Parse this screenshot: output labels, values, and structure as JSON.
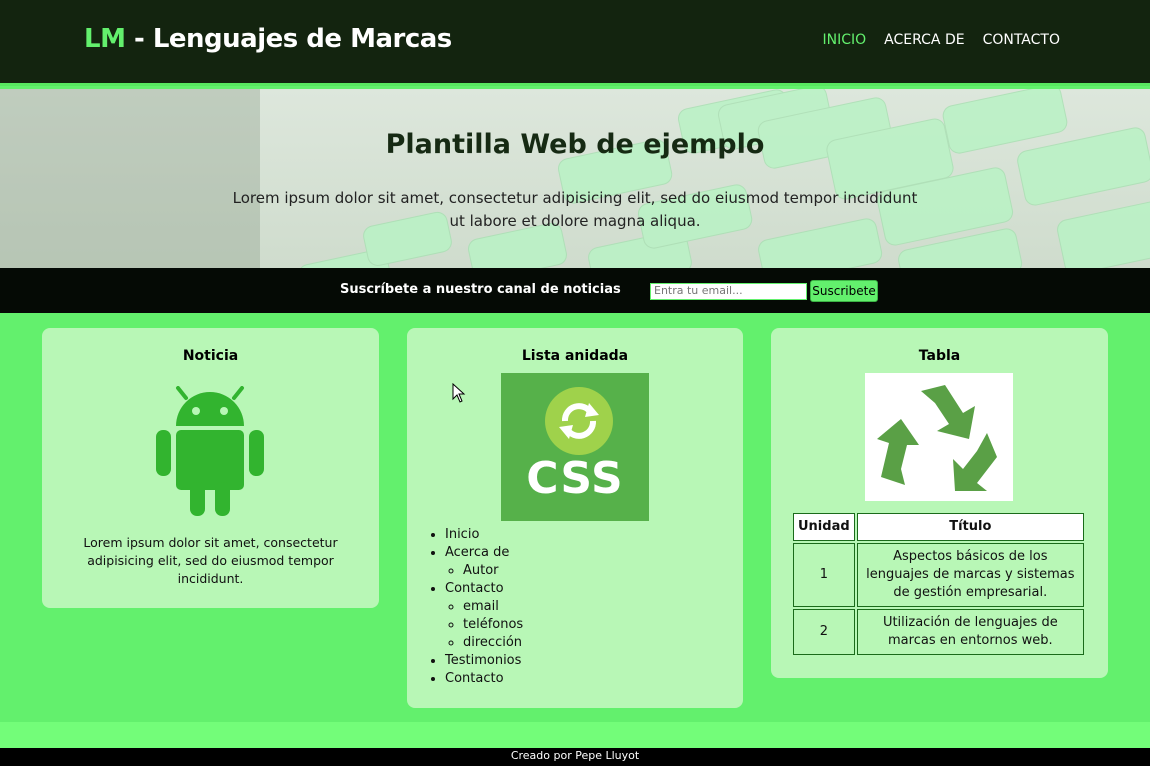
{
  "header": {
    "logo_accent": "LM",
    "logo_text": " - Lenguajes de Marcas",
    "nav": [
      {
        "label": "INICIO",
        "active": true
      },
      {
        "label": "ACERCA DE",
        "active": false
      },
      {
        "label": "CONTACTO",
        "active": false
      }
    ]
  },
  "hero": {
    "title": "Plantilla Web de ejemplo",
    "text": "Lorem ipsum dolor sit amet, consectetur adipisicing elit, sed do eiusmod tempor incididunt ut labore et dolore magna aliqua."
  },
  "subscribe": {
    "label": "Suscríbete a nuestro canal de noticias",
    "placeholder": "Entra tu email...",
    "button": "Suscribete"
  },
  "cards": {
    "news": {
      "title": "Noticia",
      "icon": "android-icon",
      "text": "Lorem ipsum dolor sit amet, consectetur adipisicing elit, sed do eiusmod tempor incididunt."
    },
    "list": {
      "title": "Lista anidada",
      "image_text": "CSS",
      "items": [
        "Inicio",
        "Acerca de",
        "Autor",
        "Contacto",
        "email",
        "teléfonos",
        "dirección",
        "Testimonios",
        "Contacto"
      ]
    },
    "table": {
      "title": "Tabla",
      "icon": "recycle-icon",
      "headers": [
        "Unidad",
        "Título"
      ],
      "rows": [
        [
          "1",
          "Aspectos básicos de los lenguajes de marcas y sistemas de gestión empresarial."
        ],
        [
          "2",
          "Utilización de lenguajes de marcas en entornos web."
        ]
      ]
    }
  },
  "footer": {
    "text": "Creado por Pepe Lluyot"
  },
  "colors": {
    "accent": "#63f06d",
    "header_bg": "#13240f",
    "card_bg": "#b8f7b6"
  }
}
